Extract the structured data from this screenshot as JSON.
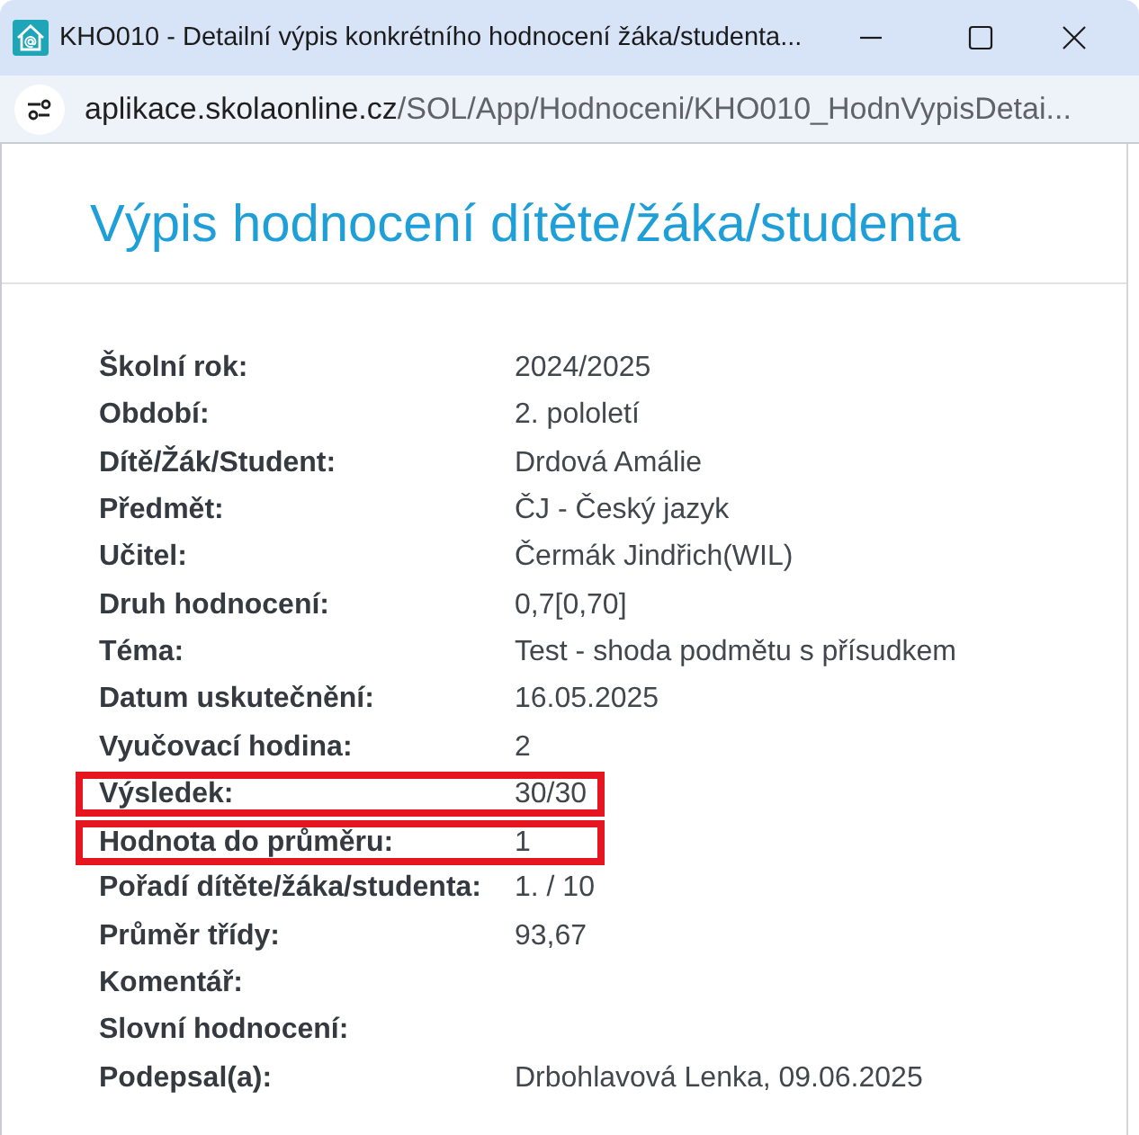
{
  "window": {
    "title": "KHO010 - Detailní výpis konkrétního hodnocení žáka/studenta..."
  },
  "address_bar": {
    "host": "aplikace.skolaonline.cz",
    "path": "/SOL/App/Hodnoceni/KHO010_HodnVypisDetai..."
  },
  "heading": "Výpis hodnocení dítěte/žáka/studenta",
  "fields": [
    {
      "label": "Školní rok:",
      "value": "2024/2025",
      "highlighted": false
    },
    {
      "label": "Období:",
      "value": "2. pololetí",
      "highlighted": false
    },
    {
      "label": "Dítě/Žák/Student:",
      "value": "Drdová Amálie",
      "highlighted": false
    },
    {
      "label": "Předmět:",
      "value": "ČJ - Český jazyk",
      "highlighted": false
    },
    {
      "label": "Učitel:",
      "value": "Čermák Jindřich(WIL)",
      "highlighted": false
    },
    {
      "label": "Druh hodnocení:",
      "value": "0,7[0,70]",
      "highlighted": false
    },
    {
      "label": "Téma:",
      "value": "Test - shoda podmětu s přísudkem",
      "highlighted": false
    },
    {
      "label": "Datum uskutečnění:",
      "value": "16.05.2025",
      "highlighted": false
    },
    {
      "label": "Vyučovací hodina:",
      "value": "2",
      "highlighted": false
    },
    {
      "label": "Výsledek:",
      "value": "30/30",
      "highlighted": true
    },
    {
      "label": "Hodnota do průměru:",
      "value": "1",
      "highlighted": true
    },
    {
      "label": "Pořadí dítěte/žáka/studenta:",
      "value": "1. / 10",
      "highlighted": false
    },
    {
      "label": "Průměr třídy:",
      "value": "93,67",
      "highlighted": false
    },
    {
      "label": "Komentář:",
      "highlighted": false
    },
    {
      "label": "Slovní hodnocení:",
      "highlighted": false
    },
    {
      "label": "Podepsal(a):",
      "value": "Drbohlavová Lenka, 09.06.2025",
      "highlighted": false
    }
  ]
}
